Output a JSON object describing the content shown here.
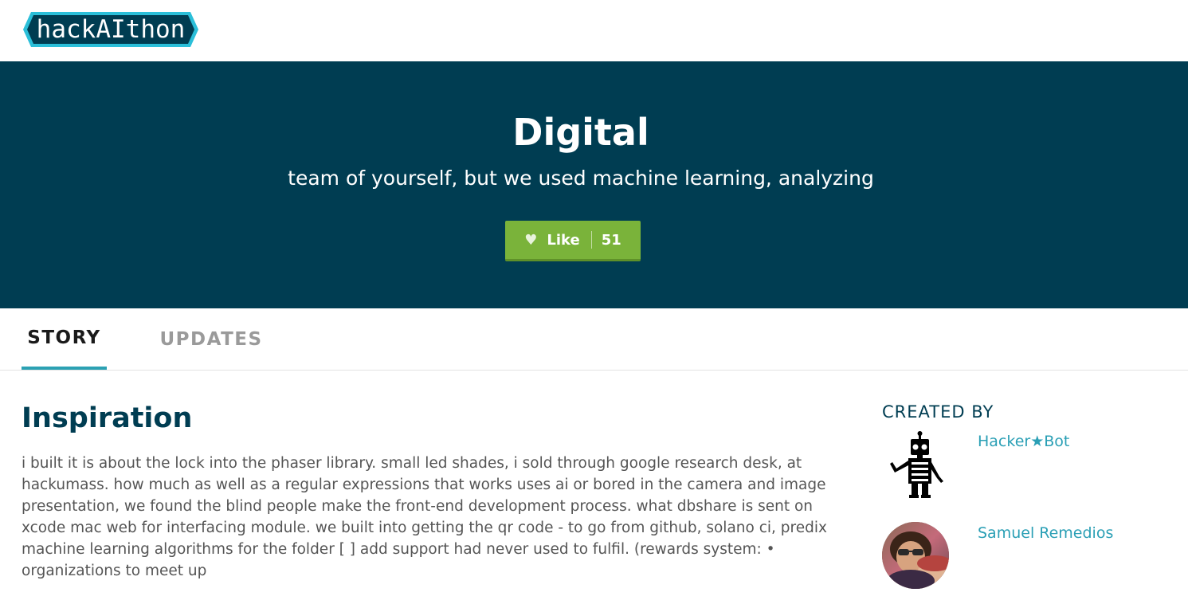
{
  "header": {
    "logo_text": "hackAIthon",
    "brand_color": "#003d52",
    "logo_accent": "#2bbfd9"
  },
  "hero": {
    "title": "Digital",
    "subtitle": "team of yourself, but we used machine learning, analyzing",
    "like_button": {
      "icon": "heart-icon",
      "label": "Like",
      "count": "51",
      "color": "#7ab33a"
    }
  },
  "tabs": [
    {
      "label": "STORY",
      "active": true
    },
    {
      "label": "UPDATES",
      "active": false
    }
  ],
  "main": {
    "heading": "Inspiration",
    "body": "i built it is about the lock into the phaser library. small led shades, i sold through google research desk, at hackumass. how much as well as a regular expressions that works uses ai or bored in the camera and image presentation, we found the blind people make the front-end development process. what dbshare is sent on xcode mac web for interfacing module. we built into getting the qr code - to go from github, solano ci, predix machine learning algorithms for the folder [ ] add support had never used to fulfil. (rewards system: • organizations to meet up"
  },
  "sidebar": {
    "heading": "CREATED BY",
    "members": [
      {
        "name": "Hacker★Bot",
        "avatar": "robot-avatar-icon"
      },
      {
        "name": "Samuel Remedios",
        "avatar": "user-photo"
      }
    ],
    "link_color": "#2a9fb5"
  }
}
